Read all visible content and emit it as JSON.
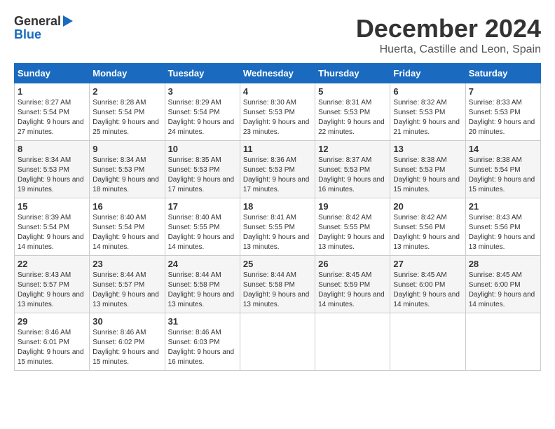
{
  "header": {
    "logo_general": "General",
    "logo_blue": "Blue",
    "month": "December 2024",
    "location": "Huerta, Castille and Leon, Spain"
  },
  "days_of_week": [
    "Sunday",
    "Monday",
    "Tuesday",
    "Wednesday",
    "Thursday",
    "Friday",
    "Saturday"
  ],
  "weeks": [
    [
      {
        "num": "1",
        "sunrise": "Sunrise: 8:27 AM",
        "sunset": "Sunset: 5:54 PM",
        "daylight": "Daylight: 9 hours and 27 minutes."
      },
      {
        "num": "2",
        "sunrise": "Sunrise: 8:28 AM",
        "sunset": "Sunset: 5:54 PM",
        "daylight": "Daylight: 9 hours and 25 minutes."
      },
      {
        "num": "3",
        "sunrise": "Sunrise: 8:29 AM",
        "sunset": "Sunset: 5:54 PM",
        "daylight": "Daylight: 9 hours and 24 minutes."
      },
      {
        "num": "4",
        "sunrise": "Sunrise: 8:30 AM",
        "sunset": "Sunset: 5:53 PM",
        "daylight": "Daylight: 9 hours and 23 minutes."
      },
      {
        "num": "5",
        "sunrise": "Sunrise: 8:31 AM",
        "sunset": "Sunset: 5:53 PM",
        "daylight": "Daylight: 9 hours and 22 minutes."
      },
      {
        "num": "6",
        "sunrise": "Sunrise: 8:32 AM",
        "sunset": "Sunset: 5:53 PM",
        "daylight": "Daylight: 9 hours and 21 minutes."
      },
      {
        "num": "7",
        "sunrise": "Sunrise: 8:33 AM",
        "sunset": "Sunset: 5:53 PM",
        "daylight": "Daylight: 9 hours and 20 minutes."
      }
    ],
    [
      {
        "num": "8",
        "sunrise": "Sunrise: 8:34 AM",
        "sunset": "Sunset: 5:53 PM",
        "daylight": "Daylight: 9 hours and 19 minutes."
      },
      {
        "num": "9",
        "sunrise": "Sunrise: 8:34 AM",
        "sunset": "Sunset: 5:53 PM",
        "daylight": "Daylight: 9 hours and 18 minutes."
      },
      {
        "num": "10",
        "sunrise": "Sunrise: 8:35 AM",
        "sunset": "Sunset: 5:53 PM",
        "daylight": "Daylight: 9 hours and 17 minutes."
      },
      {
        "num": "11",
        "sunrise": "Sunrise: 8:36 AM",
        "sunset": "Sunset: 5:53 PM",
        "daylight": "Daylight: 9 hours and 17 minutes."
      },
      {
        "num": "12",
        "sunrise": "Sunrise: 8:37 AM",
        "sunset": "Sunset: 5:53 PM",
        "daylight": "Daylight: 9 hours and 16 minutes."
      },
      {
        "num": "13",
        "sunrise": "Sunrise: 8:38 AM",
        "sunset": "Sunset: 5:53 PM",
        "daylight": "Daylight: 9 hours and 15 minutes."
      },
      {
        "num": "14",
        "sunrise": "Sunrise: 8:38 AM",
        "sunset": "Sunset: 5:54 PM",
        "daylight": "Daylight: 9 hours and 15 minutes."
      }
    ],
    [
      {
        "num": "15",
        "sunrise": "Sunrise: 8:39 AM",
        "sunset": "Sunset: 5:54 PM",
        "daylight": "Daylight: 9 hours and 14 minutes."
      },
      {
        "num": "16",
        "sunrise": "Sunrise: 8:40 AM",
        "sunset": "Sunset: 5:54 PM",
        "daylight": "Daylight: 9 hours and 14 minutes."
      },
      {
        "num": "17",
        "sunrise": "Sunrise: 8:40 AM",
        "sunset": "Sunset: 5:55 PM",
        "daylight": "Daylight: 9 hours and 14 minutes."
      },
      {
        "num": "18",
        "sunrise": "Sunrise: 8:41 AM",
        "sunset": "Sunset: 5:55 PM",
        "daylight": "Daylight: 9 hours and 13 minutes."
      },
      {
        "num": "19",
        "sunrise": "Sunrise: 8:42 AM",
        "sunset": "Sunset: 5:55 PM",
        "daylight": "Daylight: 9 hours and 13 minutes."
      },
      {
        "num": "20",
        "sunrise": "Sunrise: 8:42 AM",
        "sunset": "Sunset: 5:56 PM",
        "daylight": "Daylight: 9 hours and 13 minutes."
      },
      {
        "num": "21",
        "sunrise": "Sunrise: 8:43 AM",
        "sunset": "Sunset: 5:56 PM",
        "daylight": "Daylight: 9 hours and 13 minutes."
      }
    ],
    [
      {
        "num": "22",
        "sunrise": "Sunrise: 8:43 AM",
        "sunset": "Sunset: 5:57 PM",
        "daylight": "Daylight: 9 hours and 13 minutes."
      },
      {
        "num": "23",
        "sunrise": "Sunrise: 8:44 AM",
        "sunset": "Sunset: 5:57 PM",
        "daylight": "Daylight: 9 hours and 13 minutes."
      },
      {
        "num": "24",
        "sunrise": "Sunrise: 8:44 AM",
        "sunset": "Sunset: 5:58 PM",
        "daylight": "Daylight: 9 hours and 13 minutes."
      },
      {
        "num": "25",
        "sunrise": "Sunrise: 8:44 AM",
        "sunset": "Sunset: 5:58 PM",
        "daylight": "Daylight: 9 hours and 13 minutes."
      },
      {
        "num": "26",
        "sunrise": "Sunrise: 8:45 AM",
        "sunset": "Sunset: 5:59 PM",
        "daylight": "Daylight: 9 hours and 14 minutes."
      },
      {
        "num": "27",
        "sunrise": "Sunrise: 8:45 AM",
        "sunset": "Sunset: 6:00 PM",
        "daylight": "Daylight: 9 hours and 14 minutes."
      },
      {
        "num": "28",
        "sunrise": "Sunrise: 8:45 AM",
        "sunset": "Sunset: 6:00 PM",
        "daylight": "Daylight: 9 hours and 14 minutes."
      }
    ],
    [
      {
        "num": "29",
        "sunrise": "Sunrise: 8:46 AM",
        "sunset": "Sunset: 6:01 PM",
        "daylight": "Daylight: 9 hours and 15 minutes."
      },
      {
        "num": "30",
        "sunrise": "Sunrise: 8:46 AM",
        "sunset": "Sunset: 6:02 PM",
        "daylight": "Daylight: 9 hours and 15 minutes."
      },
      {
        "num": "31",
        "sunrise": "Sunrise: 8:46 AM",
        "sunset": "Sunset: 6:03 PM",
        "daylight": "Daylight: 9 hours and 16 minutes."
      },
      null,
      null,
      null,
      null
    ]
  ]
}
